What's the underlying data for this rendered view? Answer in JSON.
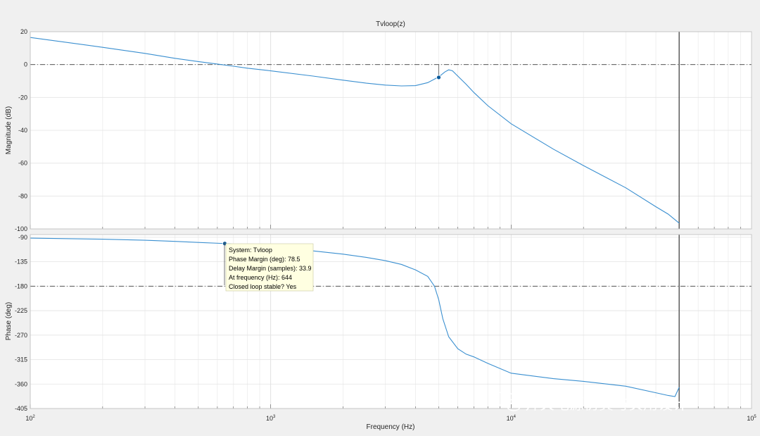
{
  "figure": {
    "title": "Tvloop(z)",
    "xlabel": "Frequency  (Hz)"
  },
  "colors": {
    "background": "#f0f0f0",
    "axes_background": "#ffffff",
    "line": "#3a8fd0",
    "grid": "#e3e3e3",
    "marker": "#0a5a9a",
    "tooltip_bg": "#ffffe1",
    "nyquist_line": "#505050"
  },
  "chart_data": [
    {
      "type": "line",
      "name": "magnitude",
      "ylabel": "Magnitude (dB)",
      "xscale": "log",
      "xlim": [
        100,
        100000
      ],
      "ylim": [
        -100,
        20
      ],
      "yticks": [
        -100,
        -80,
        -60,
        -40,
        -20,
        0,
        20
      ],
      "grid": true,
      "reference_line": 0,
      "nyquist_frequency": 50000,
      "marker": {
        "x": 5000,
        "y": -7.8
      },
      "series": [
        {
          "x": [
            100,
            200,
            300,
            400,
            500,
            600,
            700,
            800,
            1000,
            1500,
            2000,
            2500,
            3000,
            3500,
            4000,
            4500,
            5000,
            5300,
            5500,
            5700,
            6000,
            6500,
            7000,
            8000,
            10000,
            15000,
            20000,
            30000,
            40000,
            45000,
            50000
          ],
          "y": [
            16.5,
            10.5,
            6.8,
            3.8,
            1.8,
            0.3,
            -1,
            -2.2,
            -3.8,
            -7,
            -9.5,
            -11.3,
            -12.5,
            -13,
            -12.8,
            -11,
            -7.5,
            -4.5,
            -3.2,
            -3.8,
            -7,
            -12,
            -17,
            -25,
            -36,
            -51.5,
            -61.5,
            -75,
            -86.5,
            -91,
            -96.5
          ]
        }
      ]
    },
    {
      "type": "line",
      "name": "phase",
      "ylabel": "Phase (deg)",
      "xscale": "log",
      "xlim": [
        100,
        100000
      ],
      "ylim": [
        -405,
        -85
      ],
      "yticks": [
        -90,
        -135,
        -180,
        -225,
        -270,
        -315,
        -360,
        -405
      ],
      "grid": true,
      "reference_line": -180,
      "nyquist_frequency": 50000,
      "xticks": [
        {
          "value": 100,
          "base": "10",
          "exp": "2"
        },
        {
          "value": 1000,
          "base": "10",
          "exp": "3"
        },
        {
          "value": 10000,
          "base": "10",
          "exp": "4"
        },
        {
          "value": 100000,
          "base": "10",
          "exp": "5"
        }
      ],
      "marker": {
        "x": 644,
        "y": -101.5
      },
      "series": [
        {
          "x": [
            100,
            200,
            300,
            400,
            500,
            644,
            800,
            1000,
            1500,
            2000,
            2500,
            3000,
            3500,
            4000,
            4500,
            4800,
            5000,
            5200,
            5500,
            6000,
            6500,
            7000,
            8000,
            10000,
            15000,
            20000,
            30000,
            40000,
            45000,
            48000,
            50000
          ],
          "y": [
            -91.5,
            -93.5,
            -95.5,
            -97.5,
            -99.5,
            -101.5,
            -104.5,
            -108,
            -115,
            -121,
            -127,
            -133,
            -140,
            -150,
            -162,
            -180,
            -205,
            -240,
            -273,
            -295,
            -305,
            -310,
            -322,
            -340,
            -350,
            -355,
            -364,
            -376,
            -381,
            -383,
            -366
          ]
        }
      ]
    }
  ],
  "datatip": {
    "system": "System: Tvloop",
    "phase_margin": "Phase Margin (deg): 78.5",
    "delay_margin": "Delay Margin (samples): 33.9",
    "frequency": "At frequency (Hz): 644",
    "stable": "Closed loop stable? Yes"
  },
  "watermark": {
    "icon": "wechat-icon",
    "text": "开关电源仿真与实用设计"
  }
}
